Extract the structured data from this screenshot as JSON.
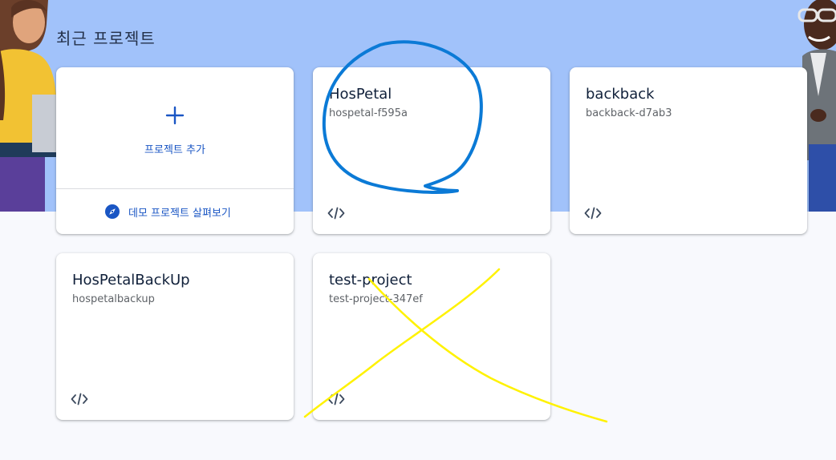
{
  "section": {
    "title": "최근 프로젝트"
  },
  "add_project": {
    "label": "프로젝트 추가",
    "demo_label": "데모 프로젝트 살펴보기",
    "plus_icon": "plus-icon",
    "demo_icon": "compass-icon"
  },
  "projects": [
    {
      "name": "HosPetal",
      "id": "hospetal-f595a",
      "icon": "code-icon"
    },
    {
      "name": "backback",
      "id": "backback-d7ab3",
      "icon": "code-icon"
    },
    {
      "name": "HosPetalBackUp",
      "id": "hospetalbackup",
      "icon": "code-icon"
    },
    {
      "name": "test-project",
      "id": "test-project-347ef",
      "icon": "code-icon"
    }
  ],
  "colors": {
    "hero_band": "#a1c2fa",
    "page_bg": "#f8f9fd",
    "accent_blue": "#1a56c4",
    "annotation_circle": "#0b7ad6",
    "annotation_cross": "#fff200"
  }
}
